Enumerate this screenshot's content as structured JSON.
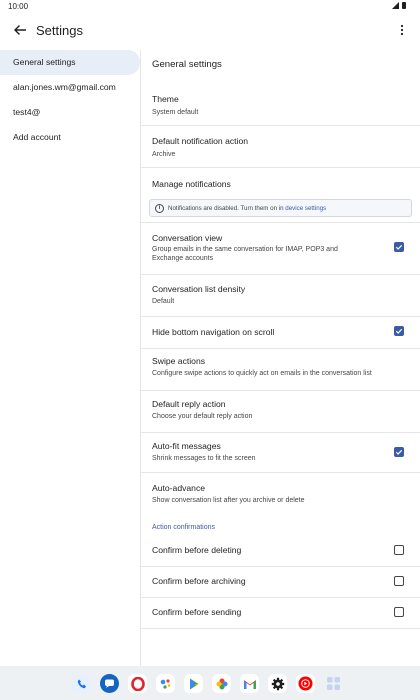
{
  "status": {
    "time": "10:00"
  },
  "appbar": {
    "title": "Settings"
  },
  "sidebar": {
    "items": [
      {
        "label": "General settings",
        "active": true
      },
      {
        "label": "alan.jones.wm@gmail.com"
      },
      {
        "label": "test4@"
      },
      {
        "label": "Add account"
      }
    ]
  },
  "main": {
    "title": "General settings",
    "theme": {
      "title": "Theme",
      "value": "System default"
    },
    "notif_action": {
      "title": "Default notification action",
      "value": "Archive"
    },
    "manage": {
      "title": "Manage notifications"
    },
    "notice": {
      "text": "Notifications are disabled. Turn them on in",
      "link": "device settings"
    },
    "conv_view": {
      "title": "Conversation view",
      "desc": "Group emails in the same conversation for IMAP, POP3 and Exchange accounts",
      "checked": true
    },
    "density": {
      "title": "Conversation list density",
      "value": "Default"
    },
    "hide_nav": {
      "title": "Hide bottom navigation on scroll",
      "checked": true
    },
    "swipe": {
      "title": "Swipe actions",
      "desc": "Configure swipe actions to quickly act on emails in the conversation list"
    },
    "reply": {
      "title": "Default reply action",
      "desc": "Choose your default reply action"
    },
    "autofit": {
      "title": "Auto-fit messages",
      "desc": "Shrink messages to fit the screen",
      "checked": true
    },
    "advance": {
      "title": "Auto-advance",
      "desc": "Show conversation list after you archive or delete"
    },
    "confirm_header": "Action confirmations",
    "confirm_delete": {
      "title": "Confirm before deleting",
      "checked": false
    },
    "confirm_archive": {
      "title": "Confirm before archiving",
      "checked": false
    },
    "confirm_send": {
      "title": "Confirm before sending",
      "checked": false
    }
  },
  "dock": {
    "apps": [
      {
        "icon": "phone-icon",
        "color": "#1a73e8"
      },
      {
        "icon": "messages-icon",
        "color": "#1565c0"
      },
      {
        "icon": "opera-icon",
        "color": "#e3242b"
      },
      {
        "icon": "assistant-icon",
        "color": "#ffffff"
      },
      {
        "icon": "play-store-icon",
        "color": "#ffffff"
      },
      {
        "icon": "photos-icon",
        "color": "#ffffff"
      },
      {
        "icon": "gmail-icon",
        "color": "#ffffff"
      },
      {
        "icon": "settings-icon",
        "color": "#ffffff"
      },
      {
        "icon": "youtube-music-icon",
        "color": "#ffffff"
      },
      {
        "icon": "app-drawer-icon",
        "color": "#c5d3f0"
      }
    ]
  }
}
